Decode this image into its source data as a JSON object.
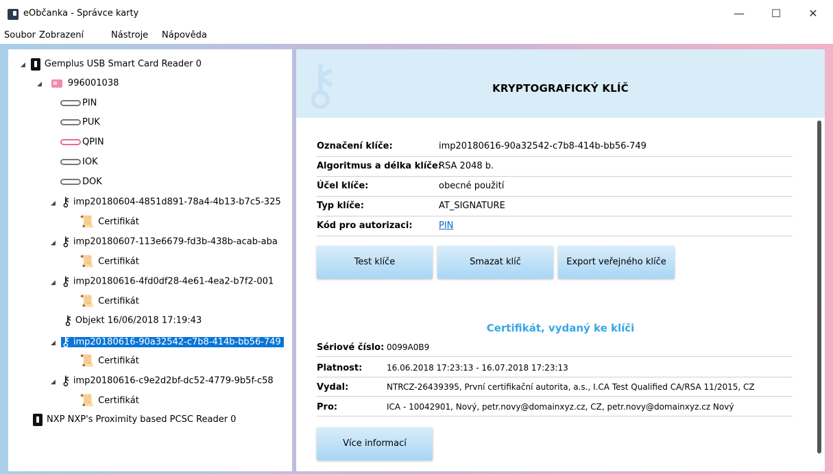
{
  "window": {
    "title": "eObčanka - Správce karty",
    "minimize": "—",
    "maximize": "☐",
    "close": "✕"
  },
  "menu": [
    "Soubor",
    "Zobrazení",
    "Nástroje",
    "Nápověda"
  ],
  "tree": {
    "reader1": "Gemplus USB Smart Card Reader 0",
    "card": "996001038",
    "pins": [
      "PIN",
      "PUK",
      "QPIN",
      "IOK",
      "DOK"
    ],
    "keys": [
      "imp20180604-4851d891-78a4-4b13-b7c5-325",
      "imp20180607-113e6679-fd3b-438b-acab-aba",
      "imp20180616-4fd0df28-4e61-4ea2-b7f2-001"
    ],
    "object": "Objekt 16/06/2018 17:19:43",
    "selected_key": "imp20180616-90a32542-c7b8-414b-bb56-749",
    "last_key": "imp20180616-c9e2d2bf-dc52-4779-9b5f-c58",
    "cert_label": "Certifikát",
    "reader2": "NXP NXP's Proximity based PCSC Reader 0"
  },
  "detail": {
    "heading": "KRYPTOGRAFICKÝ KLÍČ",
    "fields": [
      {
        "label": "Označení klíče:",
        "value": "imp20180616-90a32542-c7b8-414b-bb56-749"
      },
      {
        "label": "Algoritmus a délka klíče:",
        "value": "RSA 2048 b."
      },
      {
        "label": "Účel klíče:",
        "value": "obecné použití"
      },
      {
        "label": "Typ klíče:",
        "value": "AT_SIGNATURE"
      },
      {
        "label": "Kód pro autorizaci:",
        "value": "PIN"
      }
    ],
    "buttons": [
      "Test klíče",
      "Smazat klíč",
      "Export veřejného klíče"
    ],
    "cert_heading": "Certifikát, vydaný ke klíči",
    "cert": [
      {
        "label": "Sériové číslo:",
        "value": "0099A0B9"
      },
      {
        "label": "Platnost:",
        "value": "16.06.2018 17:23:13 - 16.07.2018 17:23:13"
      },
      {
        "label": "Vydal:",
        "value": "NTRCZ-26439395, První certifikační autorita, a.s., I.CA Test Qualified CA/RSA 11/2015, CZ"
      },
      {
        "label": "Pro:",
        "value": "ICA - 10042901, Nový, petr.novy@domainxyz.cz, CZ, petr.novy@domainxyz.cz Nový"
      }
    ],
    "more_button": "Více informací"
  }
}
